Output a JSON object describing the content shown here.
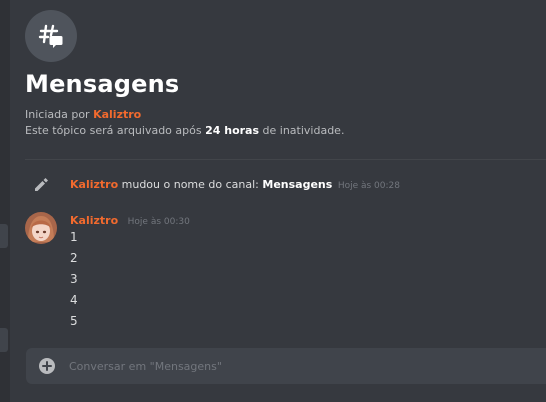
{
  "thread": {
    "icon": "thread-hashtag-icon",
    "title": "Mensagens",
    "started_prefix": "Iniciada por",
    "starter": "Kaliztro",
    "archive_prefix": "Este tópico será arquivado após",
    "archive_duration": "24 horas",
    "archive_suffix": "de inatividade."
  },
  "system_message": {
    "icon": "pencil-icon",
    "author": "Kaliztro",
    "action": "mudou o nome do canal:",
    "channel_name": "Mensagens",
    "timestamp": "Hoje às 00:28"
  },
  "message": {
    "author": "Kaliztro",
    "timestamp": "Hoje às 00:30",
    "lines": [
      "1",
      "2",
      "3",
      "4",
      "5"
    ]
  },
  "composer": {
    "placeholder": "Conversar em \"Mensagens\""
  },
  "colors": {
    "background": "#36393f",
    "author": "#f26a2e",
    "composer": "#40444b"
  }
}
